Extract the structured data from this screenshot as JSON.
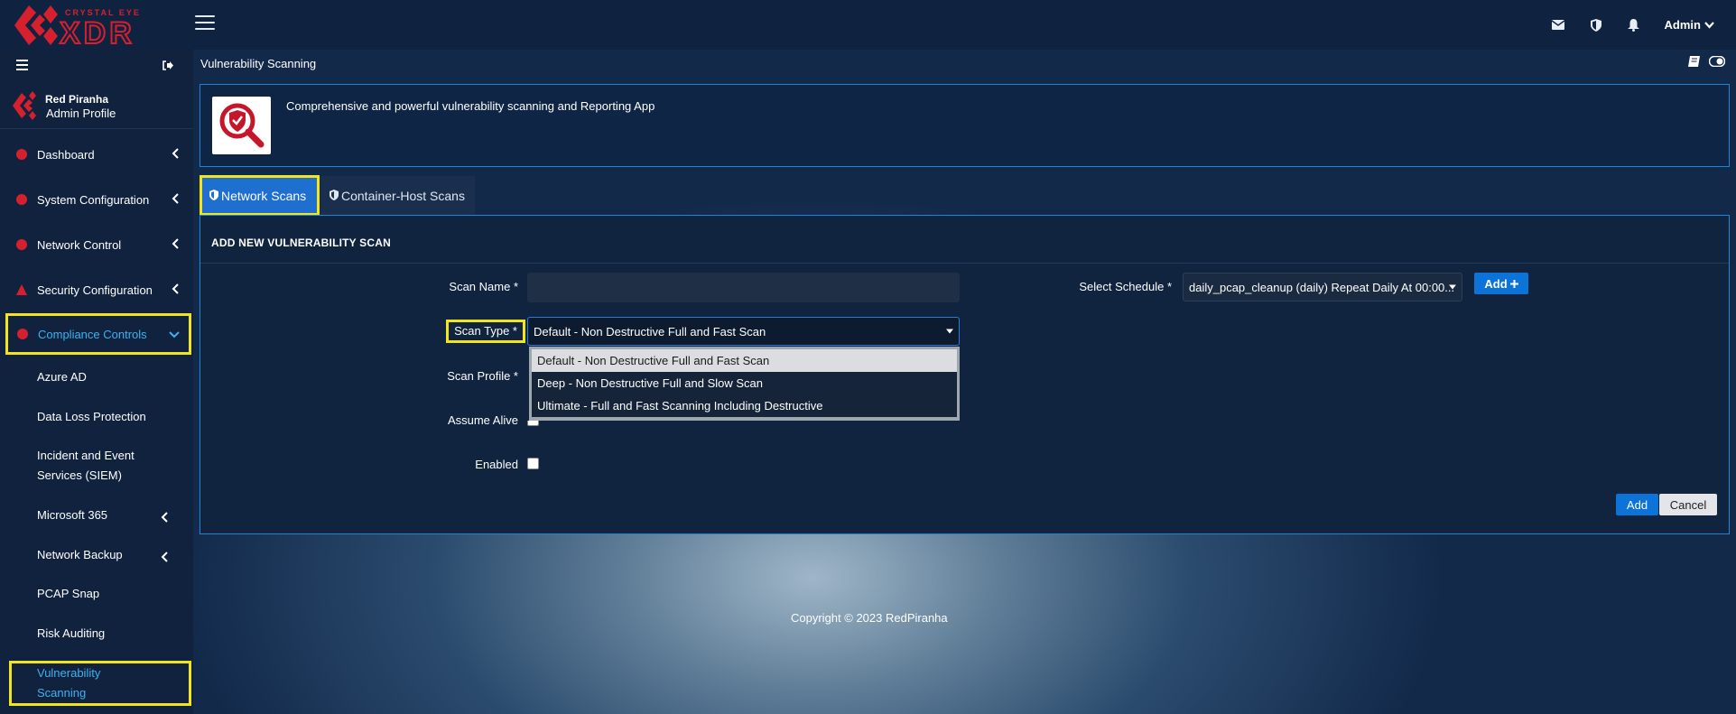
{
  "app": {
    "brand_line1": "CRYSTAL EYE",
    "brand_line2": "XDR",
    "admin_label": "Admin"
  },
  "sidebar": {
    "profile_name": "Red Piranha",
    "profile_sub": "Admin Profile",
    "items": [
      {
        "label": "Dashboard"
      },
      {
        "label": "System Configuration"
      },
      {
        "label": "Network Control"
      },
      {
        "label": "Security Configuration"
      },
      {
        "label": "Compliance Controls"
      }
    ],
    "sub_items": [
      {
        "label": "Azure AD"
      },
      {
        "label": "Data Loss Protection"
      },
      {
        "label": "Incident and Event Services (SIEM)"
      },
      {
        "label": "Microsoft 365"
      },
      {
        "label": "Network Backup"
      },
      {
        "label": "PCAP Snap"
      },
      {
        "label": "Risk Auditing"
      },
      {
        "label": "Vulnerability Scanning"
      }
    ]
  },
  "page": {
    "title": "Vulnerability Scanning",
    "hero_text": "Comprehensive and powerful vulnerability scanning and Reporting App",
    "tabs": [
      {
        "label": "Network Scans"
      },
      {
        "label": "Container-Host Scans"
      }
    ]
  },
  "form": {
    "section_title": "ADD NEW VULNERABILITY SCAN",
    "scan_name_label": "Scan Name *",
    "scan_name_value": "",
    "scan_type_label": "Scan Type *",
    "scan_type_value": "Default - Non Destructive Full and Fast Scan",
    "scan_type_options": [
      "Default - Non Destructive Full and Fast Scan",
      "Deep - Non Destructive Full and Slow Scan",
      "Ultimate - Full and Fast Scanning Including Destructive"
    ],
    "scan_profile_label": "Scan Profile *",
    "assume_alive_label": "Assume Alive",
    "enabled_label": "Enabled",
    "schedule_label": "Select Schedule *",
    "schedule_value": "daily_pcap_cleanup (daily) Repeat Daily At 00:00...",
    "add_schedule_label": "Add",
    "add_label": "Add",
    "cancel_label": "Cancel"
  },
  "footer": {
    "copyright": "Copyright © 2023 RedPiranha"
  },
  "colors": {
    "accent_blue": "#1e6fd0",
    "brand_red": "#d6202e",
    "highlight_yellow": "#f2e51c"
  }
}
